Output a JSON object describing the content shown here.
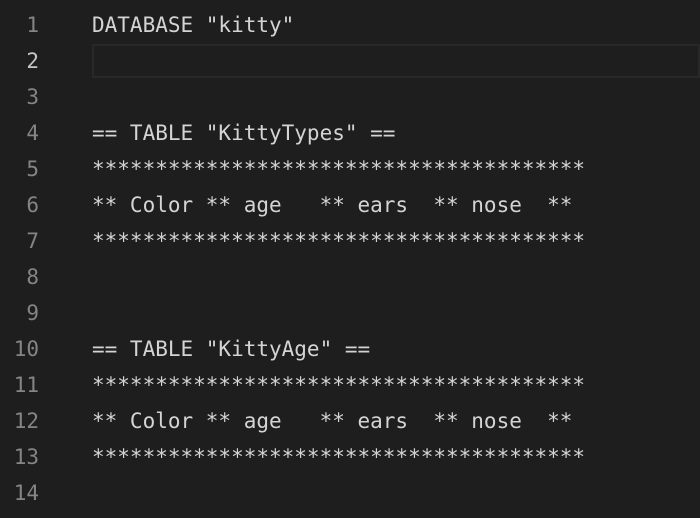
{
  "editor": {
    "line_numbers": [
      "1",
      "2",
      "3",
      "4",
      "5",
      "6",
      "7",
      "8",
      "9",
      "10",
      "11",
      "12",
      "13",
      "14"
    ],
    "active_line": 2,
    "lines": [
      "DATABASE \"kitty\"",
      "",
      "",
      "== TABLE \"KittyTypes\" ==",
      "***************************************",
      "** Color ** age   ** ears  ** nose  **",
      "***************************************",
      "",
      "",
      "== TABLE \"KittyAge\" ==",
      "***************************************",
      "** Color ** age   ** ears  ** nose  **",
      "***************************************",
      ""
    ]
  },
  "colors": {
    "background": "#1e1e1e",
    "text": "#d4d4d4",
    "line_number": "#858585",
    "line_number_active": "#c6c6c6",
    "current_line_border": "#282828"
  }
}
